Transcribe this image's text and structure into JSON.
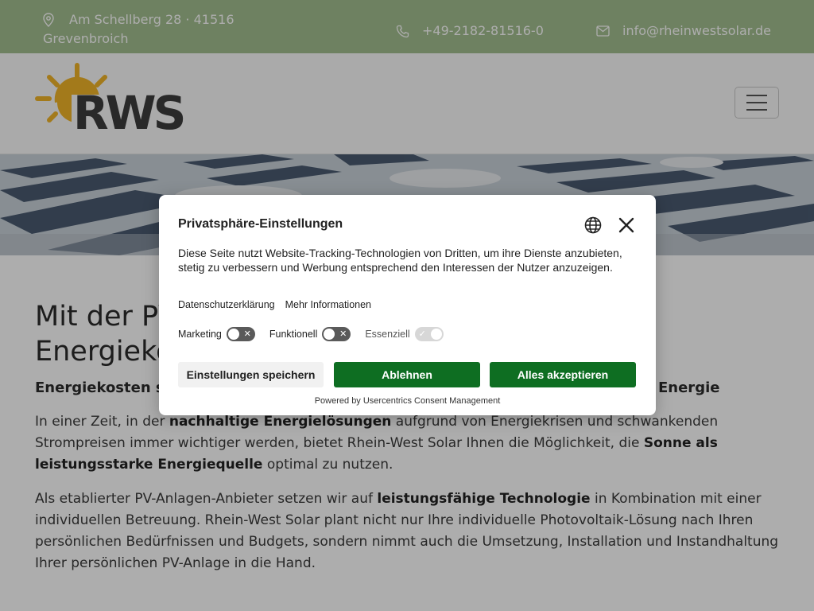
{
  "topbar": {
    "address": "Am Schellberg 28 · 41516 Grevenbroich",
    "phone": "+49-2182-81516-0",
    "email": "info@rheinwestsolar.de"
  },
  "header": {
    "logo_text": "RWS",
    "menu_icon": "hamburger-menu-icon"
  },
  "content": {
    "heading": "Mit der PV-Anlage von Rhein-West Solar Energiekosten nachhaltig senken",
    "lead": "Energiekosten senken und Umwelt schonen durch die Nutzung erneuerbarer Energie",
    "p1": {
      "a": "In einer Zeit, in der ",
      "b": "nachhaltige Energielösungen",
      "c": " aufgrund von Energiekrisen und schwankenden Strompreisen immer wichtiger werden, bietet Rhein-West Solar Ihnen die Möglichkeit, die ",
      "d": "Sonne als leistungsstarke Energiequelle",
      "e": " optimal zu nutzen."
    },
    "p2": {
      "a": "Als etablierter PV-Anlagen-Anbieter setzen wir auf ",
      "b": "leistungsfähige Technologie",
      "c": " in Kombination mit einer individuellen Betreuung. Rhein-West Solar plant nicht nur Ihre individuelle Photovoltaik-Lösung nach Ihren persönlichen Bedürfnissen und Budgets, sondern nimmt auch die Umsetzung, Installation und Instandhaltung Ihrer persönlichen PV-Anlage in die Hand."
    }
  },
  "consent": {
    "title": "Privatsphäre-Einstellungen",
    "description": "Diese Seite nutzt Website-Tracking-Technologien von Dritten, um ihre Dienste anzubieten, stetig zu verbessern und Werbung entsprechend den Interessen der Nutzer anzuzeigen.",
    "link_privacy": "Datenschutzerklärung",
    "link_more": "Mehr Informationen",
    "toggles": [
      {
        "label": "Marketing",
        "state": "off"
      },
      {
        "label": "Funktionell",
        "state": "off"
      },
      {
        "label": "Essenziell",
        "state": "on-disabled"
      }
    ],
    "btn_save": "Einstellungen speichern",
    "btn_deny": "Ablehnen",
    "btn_accept": "Alles akzeptieren",
    "powered_by": "Powered by Usercentrics Consent Management",
    "colors": {
      "primary_button": "#0e6e22",
      "topbar": "#a3bf8f"
    }
  }
}
